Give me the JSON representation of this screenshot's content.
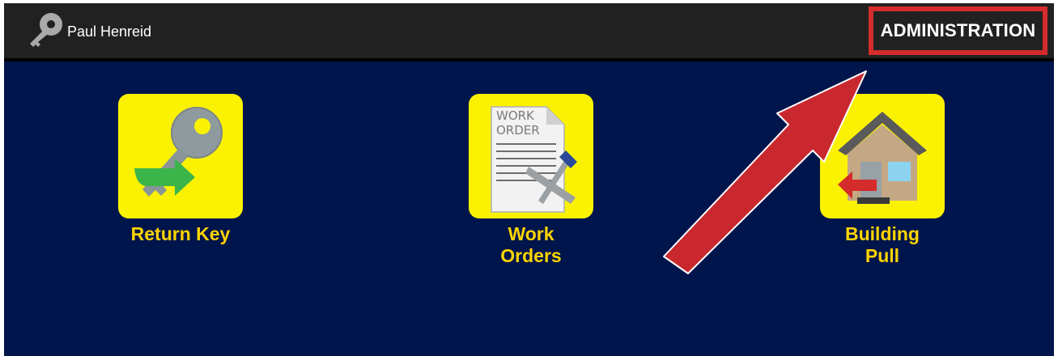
{
  "header": {
    "user_name": "Paul Henreid",
    "user_icon": "key-icon",
    "admin_label": "ADMINISTRATION"
  },
  "tiles": [
    {
      "label_line1": "Return Key",
      "label_line2": "",
      "icon": "return-key-icon"
    },
    {
      "label_line1": "Work",
      "label_line2": "Orders",
      "icon": "work-order-icon",
      "doc_text_1": "WORK",
      "doc_text_2": "ORDER"
    },
    {
      "label_line1": "Building",
      "label_line2": "Pull",
      "icon": "building-pull-icon"
    }
  ],
  "colors": {
    "topbar": "#212121",
    "content_bg": "#00154b",
    "tile_bg": "#fbf203",
    "tile_label": "#ffd400",
    "highlight": "#d42b2b"
  }
}
